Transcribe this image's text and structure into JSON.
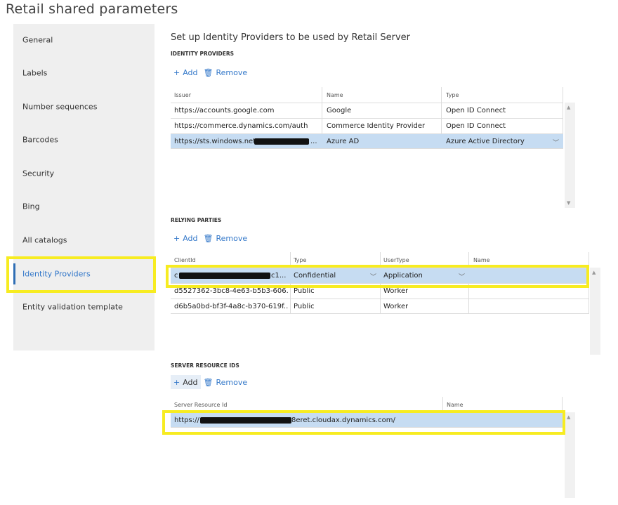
{
  "page": {
    "title": "Retail shared parameters"
  },
  "sidebar": {
    "items": [
      {
        "label": "General"
      },
      {
        "label": "Labels"
      },
      {
        "label": "Number sequences"
      },
      {
        "label": "Barcodes"
      },
      {
        "label": "Security"
      },
      {
        "label": "Bing"
      },
      {
        "label": "All catalogs"
      },
      {
        "label": "Identity Providers",
        "active": true
      },
      {
        "label": "Entity validation template"
      }
    ]
  },
  "main": {
    "intro": "Set up Identity Providers to be used by Retail Server",
    "identity_providers": {
      "heading": "IDENTITY PROVIDERS",
      "add_label": "Add",
      "remove_label": "Remove",
      "columns": [
        "Issuer",
        "Name",
        "Type"
      ],
      "rows": [
        {
          "issuer": "https://accounts.google.com",
          "name": "Google",
          "type": "Open ID Connect"
        },
        {
          "issuer": "https://commerce.dynamics.com/auth",
          "name": "Commerce Identity Provider",
          "type": "Open ID Connect"
        },
        {
          "issuer_prefix": "https://sts.windows.net/",
          "issuer_suffix": "...",
          "name": "Azure AD",
          "type": "Azure Active Directory"
        }
      ]
    },
    "relying_parties": {
      "heading": "RELYING PARTIES",
      "add_label": "Add",
      "remove_label": "Remove",
      "columns": [
        "ClientId",
        "Type",
        "UserType",
        "Name"
      ],
      "rows": [
        {
          "client_prefix": "c",
          "client_suffix": "c1...",
          "type": "Confidential",
          "user_type": "Application",
          "name": ""
        },
        {
          "client": "d5527362-3bc8-4e63-b5b3-606...",
          "type": "Public",
          "user_type": "Worker",
          "name": ""
        },
        {
          "client": "d6b5a0bd-bf3f-4a8c-b370-619f...",
          "type": "Public",
          "user_type": "Worker",
          "name": ""
        }
      ]
    },
    "server_resource_ids": {
      "heading": "SERVER RESOURCE IDS",
      "add_label": "Add",
      "remove_label": "Remove",
      "columns": [
        "Server Resource Id",
        "Name"
      ],
      "rows": [
        {
          "id_prefix": "https://",
          "id_suffix": "8eret.cloudax.dynamics.com/",
          "name": ""
        }
      ]
    }
  },
  "colors": {
    "accent": "#3277c9",
    "selected_row": "#c6dcf2",
    "highlight": "#f7ec21"
  }
}
